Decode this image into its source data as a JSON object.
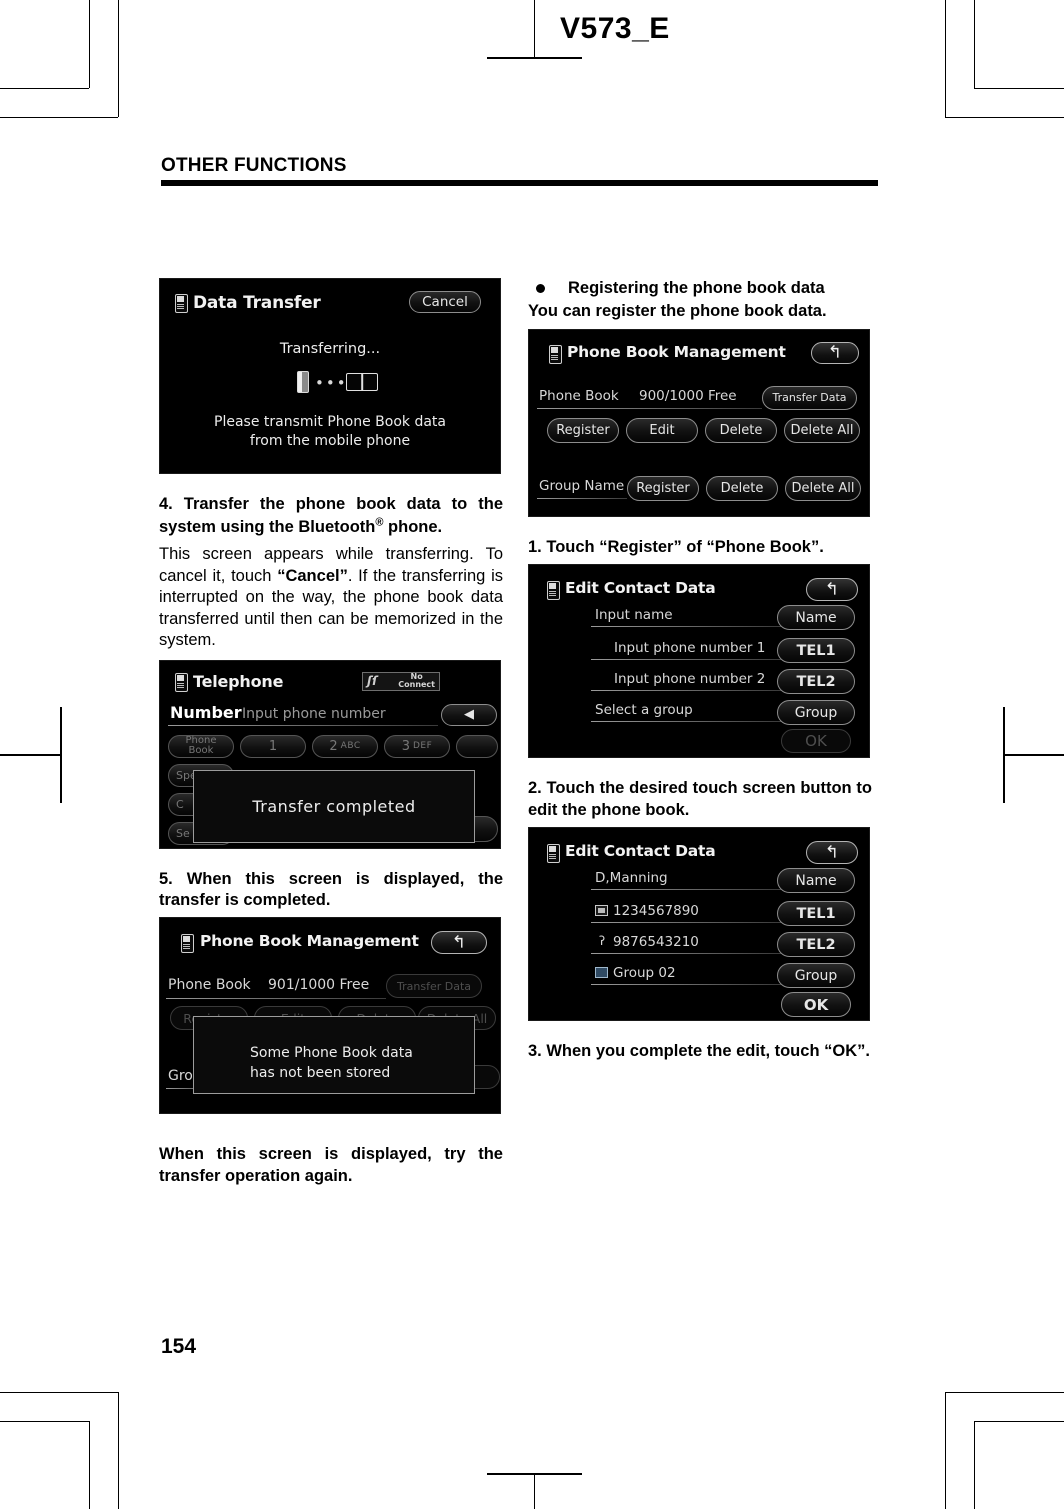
{
  "page": {
    "doc_code": "V573_E",
    "section_title": "OTHER FUNCTIONS",
    "page_number": "154"
  },
  "left_column": {
    "shot_data_transfer": {
      "title": "Data Transfer",
      "cancel_label": "Cancel",
      "status": "Transferring...",
      "message_line1": "Please transmit Phone Book data",
      "message_line2": "from the mobile phone",
      "icons": [
        "mobile-phone-icon",
        "dots-icon",
        "phone-book-icon"
      ]
    },
    "step4_heading": "4.  Transfer the phone book data to the system using the Bluetooth® phone.",
    "step4_body_a": "This screen appears while transferring. To cancel it, touch ",
    "step4_body_b": "“Cancel”",
    "step4_body_c": ".   If the transferring is interrupted on the way, the phone book data transferred until then can be memorized in the system.",
    "shot_telephone": {
      "title": "Telephone",
      "status_signal": "signal-icon",
      "status_text_line1": "No",
      "status_text_line2": "Connect",
      "number_label": "Number",
      "number_placeholder": "Input phone number",
      "keys": [
        "Phone Book",
        "1",
        "2 ABC",
        "3 DEF"
      ],
      "key_row2_partial": [
        "Spe"
      ],
      "key_row3_partial": [
        "C"
      ],
      "key_row4_partial": [
        "Se"
      ],
      "popup_text": "Transfer completed"
    },
    "step5_heading": "5.   When this screen is displayed, the transfer is completed.",
    "shot_phone_book_mgmt_901": {
      "title": "Phone Book Management",
      "back_icon": "back-arrow-icon",
      "phone_book_label": "Phone Book",
      "capacity": "901/1000 Free",
      "transfer_data_label": "Transfer Data",
      "row_buttons": [
        "Register",
        "Edit",
        "Delete",
        "Delete All"
      ],
      "group_label": "Grou",
      "popup_line1": "Some Phone Book data",
      "popup_line2": "has not been stored"
    },
    "closing_note": "When this screen is displayed, try the transfer operation again."
  },
  "right_column": {
    "bullet_heading": "Registering the phone book data",
    "lead_text": "You can register the phone book data.",
    "shot_phone_book_mgmt_900": {
      "title": "Phone Book Management",
      "back_icon": "back-arrow-icon",
      "phone_book_label": "Phone Book",
      "capacity": "900/1000 Free",
      "transfer_data_label": "Transfer Data",
      "row_buttons": [
        "Register",
        "Edit",
        "Delete",
        "Delete All"
      ],
      "group_name_label": "Group Name",
      "group_buttons": [
        "Register",
        "Delete",
        "Delete All"
      ]
    },
    "step1": "1.  Touch  “Register”  of  “Phone Book”.",
    "shot_edit_contact_empty": {
      "title": "Edit Contact Data",
      "back_icon": "back-arrow-icon",
      "rows": [
        {
          "value": "Input name",
          "button": "Name"
        },
        {
          "value": "Input phone number 1",
          "button": "TEL1"
        },
        {
          "value": "Input phone number 2",
          "button": "TEL2"
        },
        {
          "value": "Select a group",
          "button": "Group"
        }
      ],
      "ok_label": "OK",
      "ok_enabled": false
    },
    "step2": "2.   Touch the desired touch screen button to edit the phone book.",
    "shot_edit_contact_filled": {
      "title": "Edit Contact Data",
      "back_icon": "back-arrow-icon",
      "rows": [
        {
          "value": "D,Manning",
          "button": "Name",
          "icon": ""
        },
        {
          "value": "1234567890",
          "button": "TEL1",
          "icon": "home-phone-icon"
        },
        {
          "value": "9876543210",
          "button": "TEL2",
          "icon": "mobile-phone-icon"
        },
        {
          "value": "Group 02",
          "button": "Group",
          "icon": "group-list-icon"
        }
      ],
      "ok_label": "OK",
      "ok_enabled": true
    },
    "step3": "3.  When you complete the edit, touch “OK”."
  }
}
